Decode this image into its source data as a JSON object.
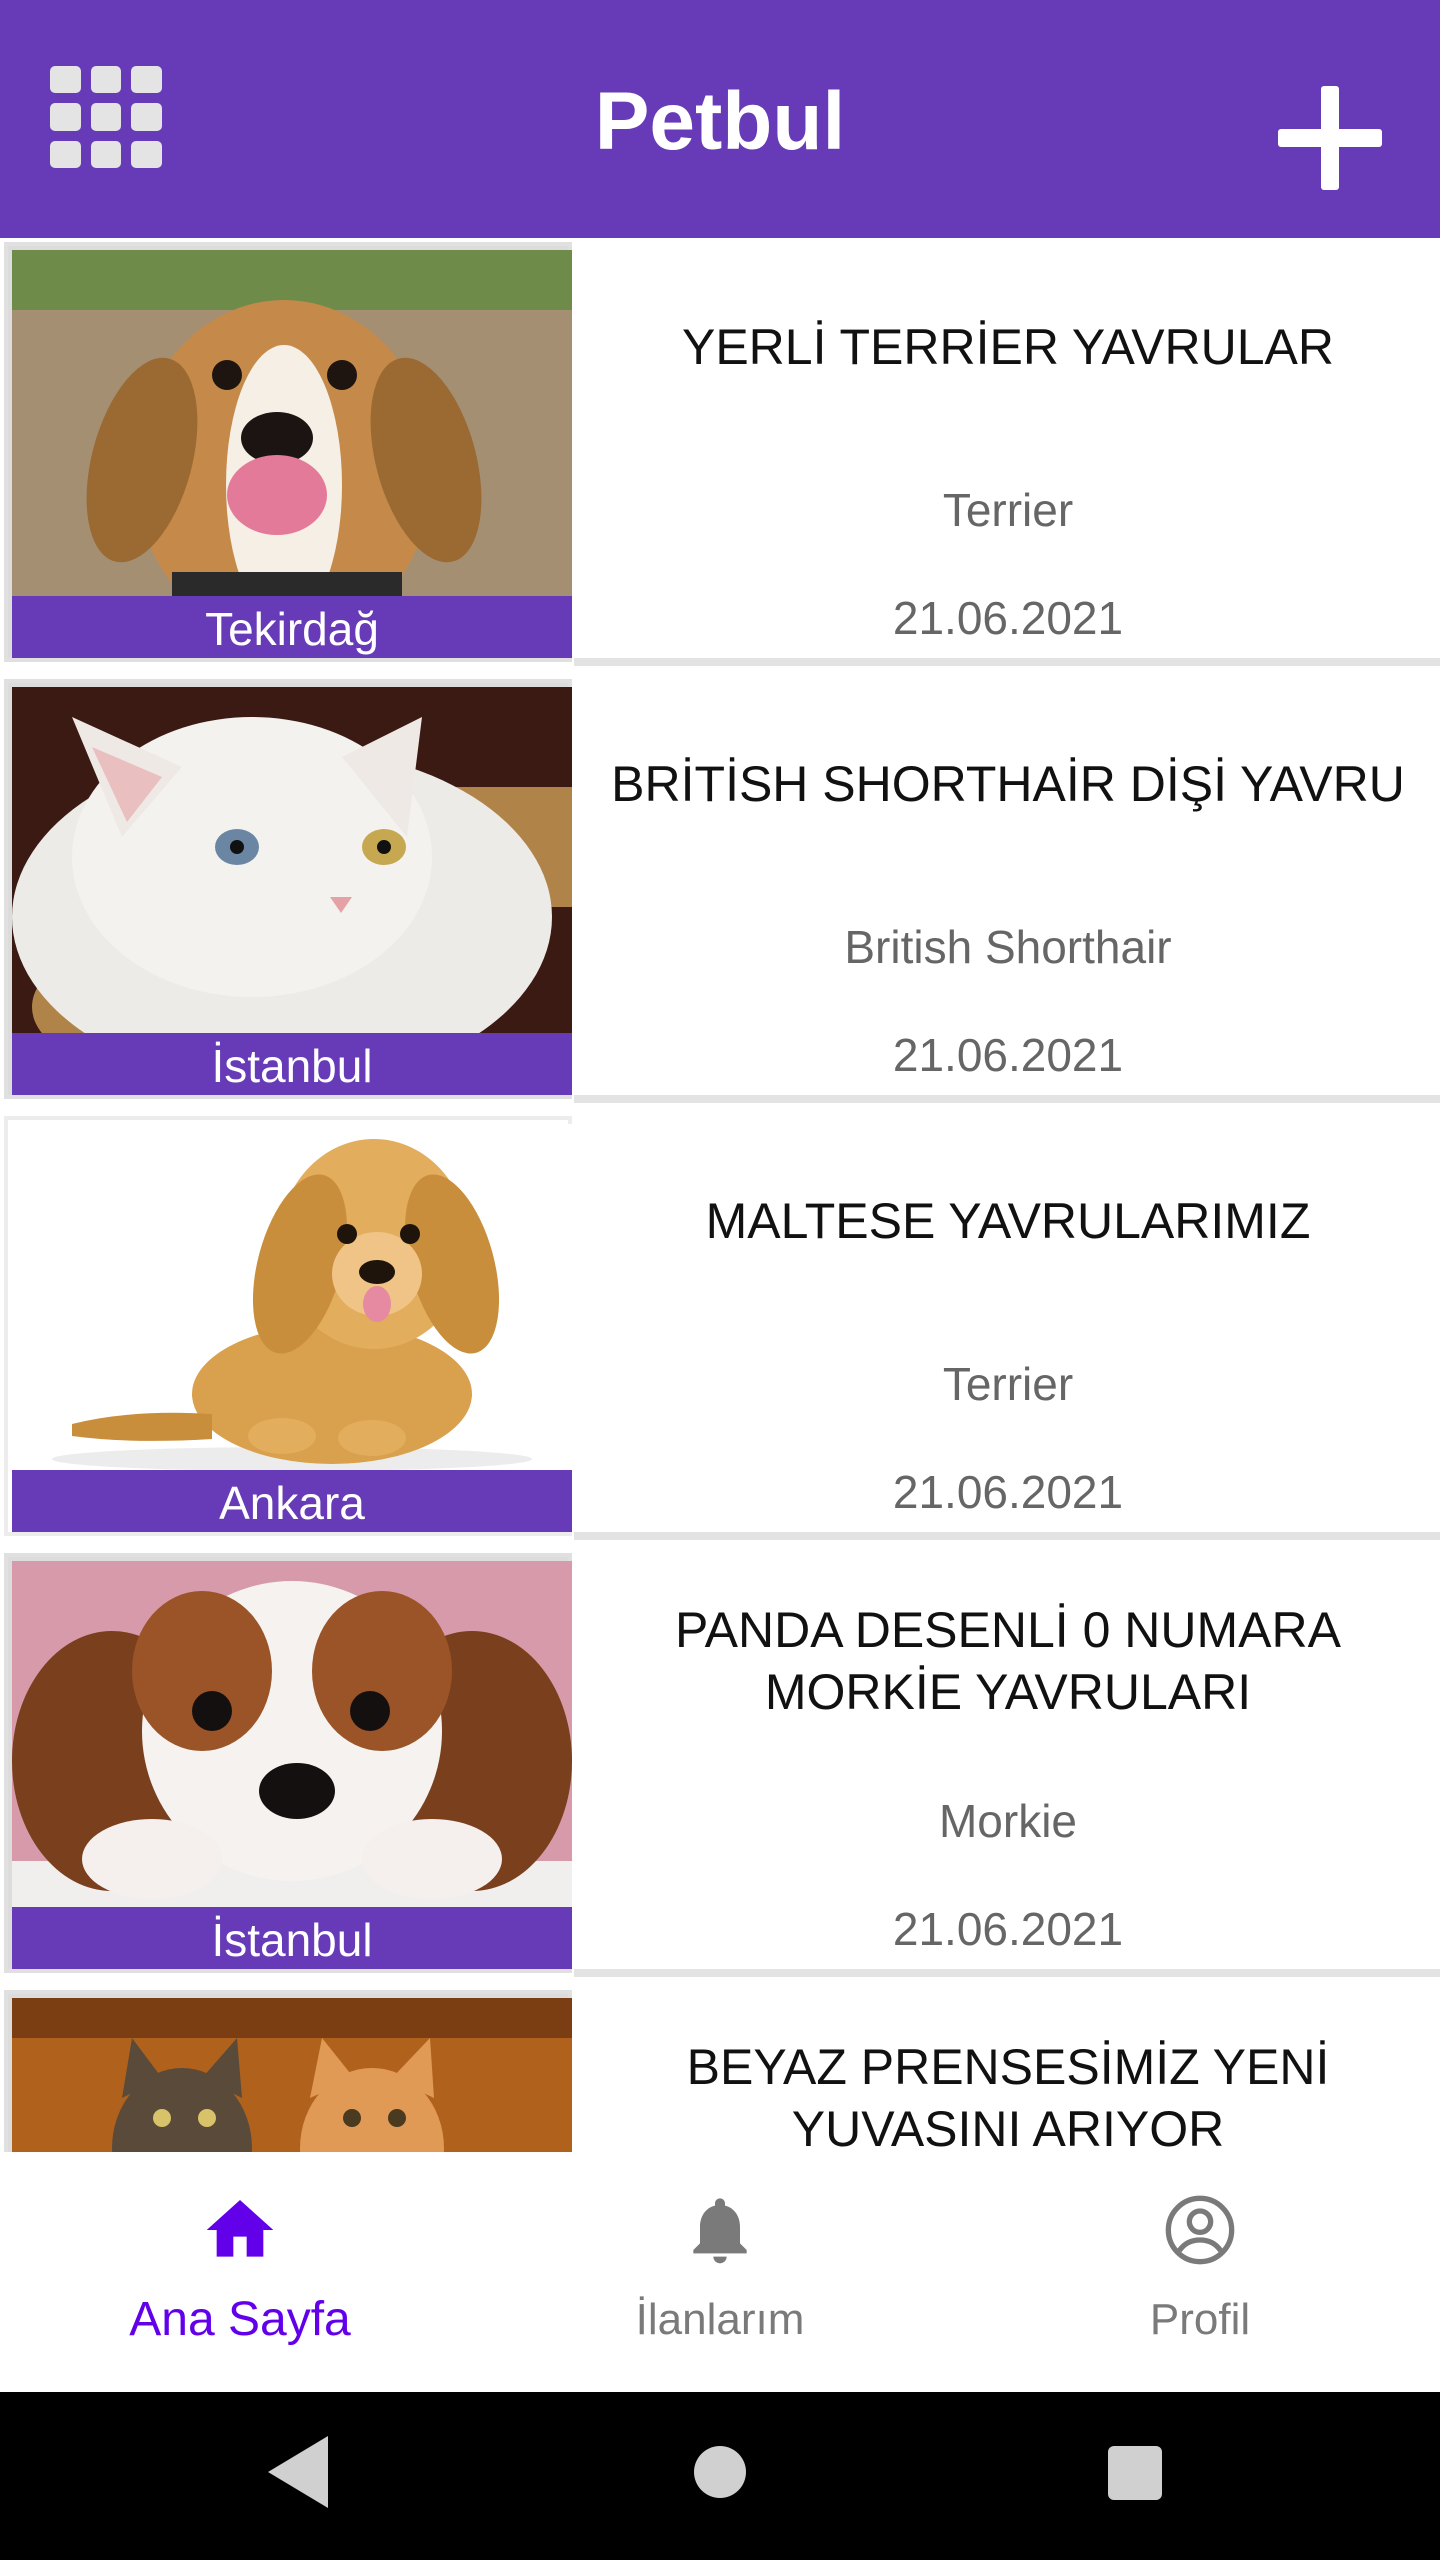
{
  "app": {
    "title": "Petbul"
  },
  "listings": [
    {
      "title": "YERLİ TERRİER YAVRULAR",
      "breed": "Terrier",
      "date": "21.06.2021",
      "city": "Tekirdağ",
      "photo": "beagle-photo"
    },
    {
      "title": "BRİTİSH SHORTHAİR DİŞİ YAVRU",
      "breed": "British Shorthair",
      "date": "21.06.2021",
      "city": "İstanbul",
      "photo": "white-cat-photo"
    },
    {
      "title": "MALTESE YAVRULARIMIZ",
      "breed": "Terrier",
      "date": "21.06.2021",
      "city": "Ankara",
      "photo": "golden-puppy-photo"
    },
    {
      "title": "PANDA DESENLİ 0 NUMARA MORKİE YAVRULARI",
      "breed": "Morkie",
      "date": "21.06.2021",
      "city": "İstanbul",
      "photo": "cavalier-puppy-photo"
    },
    {
      "title": "BEYAZ PRENSESİMİZ YENİ YUVASINI ARIYOR",
      "photo": "two-cats-photo"
    }
  ],
  "bottom_nav": [
    {
      "label": "Ana Sayfa",
      "icon": "home-icon",
      "active": true
    },
    {
      "label": "İlanlarım",
      "icon": "bell-icon",
      "active": false
    },
    {
      "label": "Profil",
      "icon": "account-circle-icon",
      "active": false
    }
  ],
  "colors": {
    "primary": "#673ab7",
    "active_nav": "#6200ea",
    "inactive_nav": "#7a7a7a"
  }
}
